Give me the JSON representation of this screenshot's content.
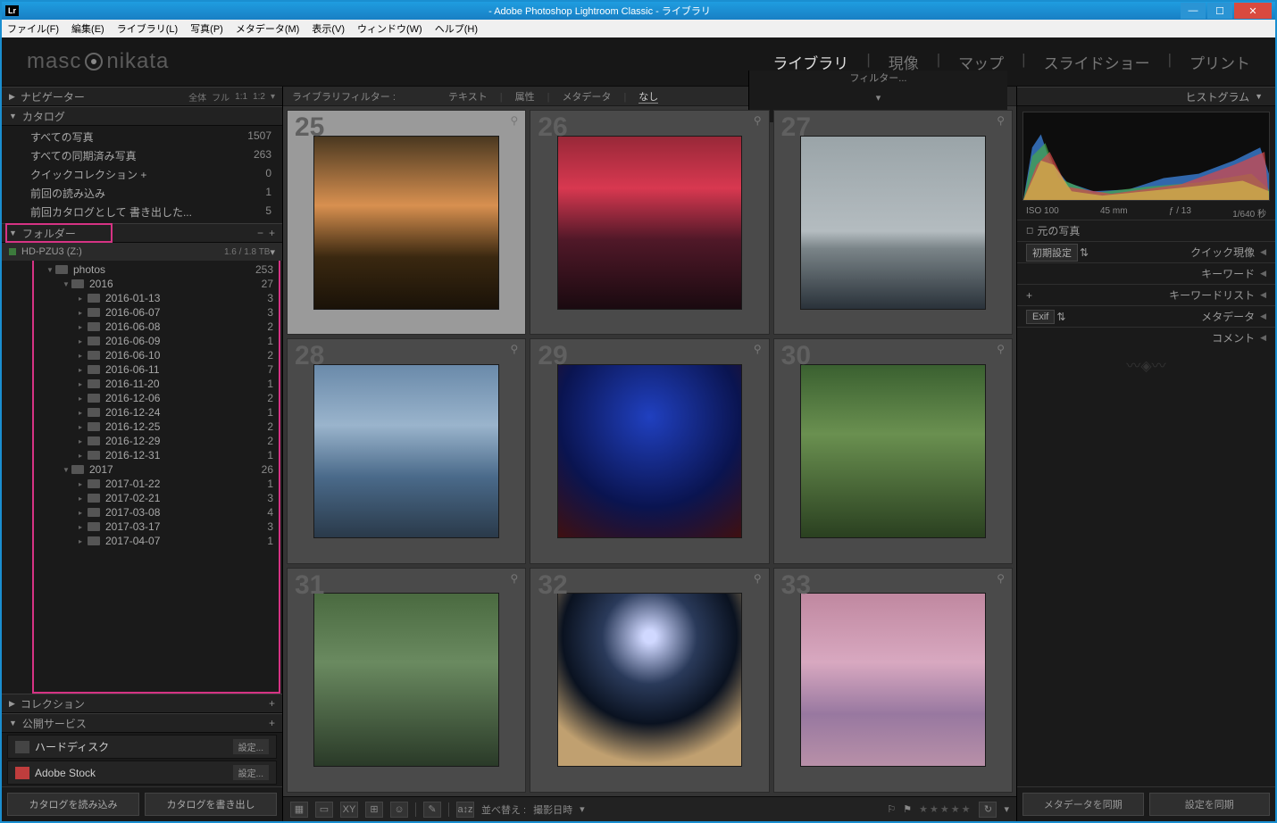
{
  "titlebar": {
    "badge": "Lr",
    "title": " - Adobe Photoshop Lightroom Classic - ライブラリ"
  },
  "menubar": [
    "ファイル(F)",
    "編集(E)",
    "ライブラリ(L)",
    "写真(P)",
    "メタデータ(M)",
    "表示(V)",
    "ウィンドウ(W)",
    "ヘルプ(H)"
  ],
  "brand": {
    "left": "masc",
    "right": "nikata"
  },
  "modules": [
    {
      "label": "ライブラリ",
      "active": true
    },
    {
      "label": "現像"
    },
    {
      "label": "マップ"
    },
    {
      "label": "スライドショー"
    },
    {
      "label": "プリント"
    }
  ],
  "left": {
    "navigator": {
      "title": "ナビゲーター",
      "options": [
        "全体",
        "フル",
        "1:1",
        "1:2"
      ]
    },
    "catalog": {
      "title": "カタログ",
      "items": [
        {
          "label": "すべての写真",
          "count": "1507"
        },
        {
          "label": "すべての同期済み写真",
          "count": "263"
        },
        {
          "label": "クイックコレクション  +",
          "count": "0"
        },
        {
          "label": "前回の読み込み",
          "count": "1"
        },
        {
          "label": "前回カタログとして 書き出した...",
          "count": "5"
        }
      ]
    },
    "folders": {
      "title": "フォルダー",
      "drive": {
        "name": "HD-PZU3 (Z:)",
        "usage": "1.6 / 1.8 TB"
      },
      "tree": [
        {
          "depth": 0,
          "arrow": "▼",
          "name": "photos",
          "count": "253"
        },
        {
          "depth": 1,
          "arrow": "▼",
          "name": "2016",
          "count": "27"
        },
        {
          "depth": 2,
          "arrow": "",
          "name": "2016-01-13",
          "count": "3"
        },
        {
          "depth": 2,
          "arrow": "",
          "name": "2016-06-07",
          "count": "3"
        },
        {
          "depth": 2,
          "arrow": "",
          "name": "2016-06-08",
          "count": "2"
        },
        {
          "depth": 2,
          "arrow": "",
          "name": "2016-06-09",
          "count": "1"
        },
        {
          "depth": 2,
          "arrow": "",
          "name": "2016-06-10",
          "count": "2"
        },
        {
          "depth": 2,
          "arrow": "",
          "name": "2016-06-11",
          "count": "7"
        },
        {
          "depth": 2,
          "arrow": "",
          "name": "2016-11-20",
          "count": "1"
        },
        {
          "depth": 2,
          "arrow": "",
          "name": "2016-12-06",
          "count": "2"
        },
        {
          "depth": 2,
          "arrow": "",
          "name": "2016-12-24",
          "count": "1"
        },
        {
          "depth": 2,
          "arrow": "",
          "name": "2016-12-25",
          "count": "2"
        },
        {
          "depth": 2,
          "arrow": "",
          "name": "2016-12-29",
          "count": "2"
        },
        {
          "depth": 2,
          "arrow": "",
          "name": "2016-12-31",
          "count": "1"
        },
        {
          "depth": 1,
          "arrow": "▼",
          "name": "2017",
          "count": "26"
        },
        {
          "depth": 2,
          "arrow": "",
          "name": "2017-01-22",
          "count": "1"
        },
        {
          "depth": 2,
          "arrow": "",
          "name": "2017-02-21",
          "count": "3"
        },
        {
          "depth": 2,
          "arrow": "",
          "name": "2017-03-08",
          "count": "4"
        },
        {
          "depth": 2,
          "arrow": "",
          "name": "2017-03-17",
          "count": "3"
        },
        {
          "depth": 2,
          "arrow": "",
          "name": "2017-04-07",
          "count": "1"
        }
      ]
    },
    "collections": {
      "title": "コレクション"
    },
    "publish": {
      "title": "公開サービス",
      "items": [
        {
          "ico": "hd",
          "name": "ハードディスク",
          "setup": "設定..."
        },
        {
          "ico": "stock",
          "name": "Adobe Stock",
          "setup": "設定..."
        }
      ]
    },
    "footer": {
      "import": "カタログを読み込み",
      "export": "カタログを書き出し"
    }
  },
  "filter": {
    "label": "ライブラリフィルター :",
    "tabs": [
      "テキスト",
      "属性",
      "メタデータ",
      "なし"
    ],
    "active": 3,
    "preset": "フィルター..."
  },
  "grid": [
    {
      "num": "25",
      "cls": "g25",
      "selected": true
    },
    {
      "num": "26",
      "cls": "g26"
    },
    {
      "num": "27",
      "cls": "g27"
    },
    {
      "num": "28",
      "cls": "g28"
    },
    {
      "num": "29",
      "cls": "g29"
    },
    {
      "num": "30",
      "cls": "g30"
    },
    {
      "num": "31",
      "cls": "g31"
    },
    {
      "num": "32",
      "cls": "g32"
    },
    {
      "num": "33",
      "cls": "g33"
    }
  ],
  "bottombar": {
    "sort_label": "並べ替え :",
    "sort_value": "撮影日時"
  },
  "right": {
    "histogram": {
      "title": "ヒストグラム",
      "iso": "ISO 100",
      "focal": "45 mm",
      "aperture": "ƒ / 13",
      "shutter": "1/640 秒",
      "original": "元の写真"
    },
    "quick_dev": {
      "preset": "初期設定",
      "title": "クイック現像"
    },
    "keyword": "キーワード",
    "keyword_list": "キーワードリスト",
    "metadata": {
      "preset": "Exif",
      "title": "メタデータ"
    },
    "comment": "コメント",
    "footer": {
      "sync_meta": "メタデータを同期",
      "sync_settings": "設定を同期"
    }
  }
}
